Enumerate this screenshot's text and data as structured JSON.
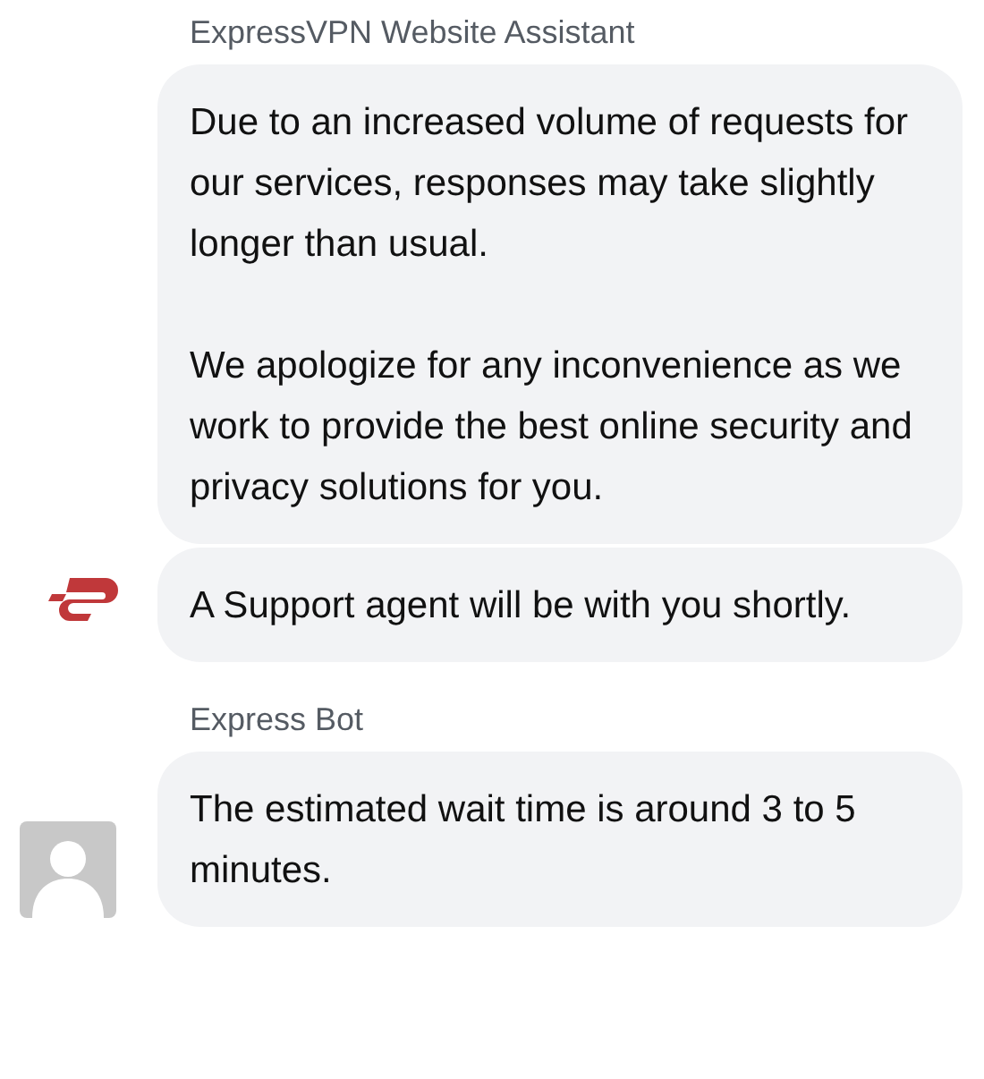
{
  "groups": [
    {
      "sender": "ExpressVPN Website Assistant",
      "avatar": {
        "kind": "logo"
      },
      "messages": [
        {
          "paragraphs": [
            "Due to an increased volume of requests for our services, responses may take slightly longer than usual.",
            "We apologize for any inconvenience as we work to provide the best online security and privacy solutions for you."
          ]
        },
        {
          "paragraphs": [
            "A Support agent will be with you shortly."
          ]
        }
      ]
    },
    {
      "sender": "Express Bot",
      "avatar": {
        "kind": "default"
      },
      "messages": [
        {
          "paragraphs": [
            "The estimated wait time is around 3 to 5 minutes."
          ]
        }
      ]
    }
  ]
}
